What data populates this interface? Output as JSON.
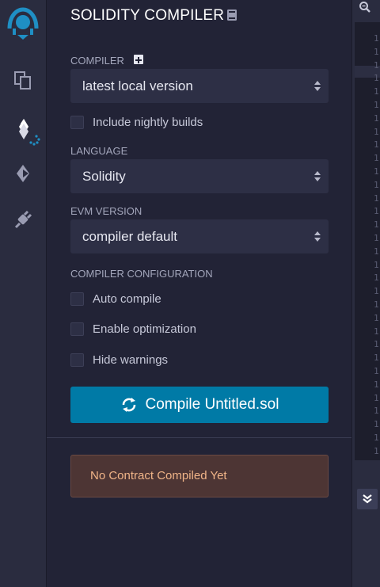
{
  "rail": {
    "icons": [
      "remix-logo-icon",
      "file-explorer-icon",
      "solidity-compiler-icon",
      "deploy-run-icon",
      "plugin-manager-icon"
    ]
  },
  "panel": {
    "title": "SOLIDITY COMPILER",
    "compiler_label": "COMPILER",
    "compiler_value": "latest local version",
    "nightly_label": "Include nightly builds",
    "language_label": "LANGUAGE",
    "language_value": "Solidity",
    "evm_label": "EVM VERSION",
    "evm_value": "compiler default",
    "config_label": "COMPILER CONFIGURATION",
    "auto_compile_label": "Auto compile",
    "optimization_label": "Enable optimization",
    "hide_warnings_label": "Hide warnings",
    "compile_button_label": "Compile Untitled.sol",
    "status_message": "No Contract Compiled Yet"
  },
  "editor": {
    "line_digit": "1"
  },
  "colors": {
    "accent": "#007aa6",
    "alert_bg": "#4d3534",
    "alert_text": "#f0b488"
  }
}
